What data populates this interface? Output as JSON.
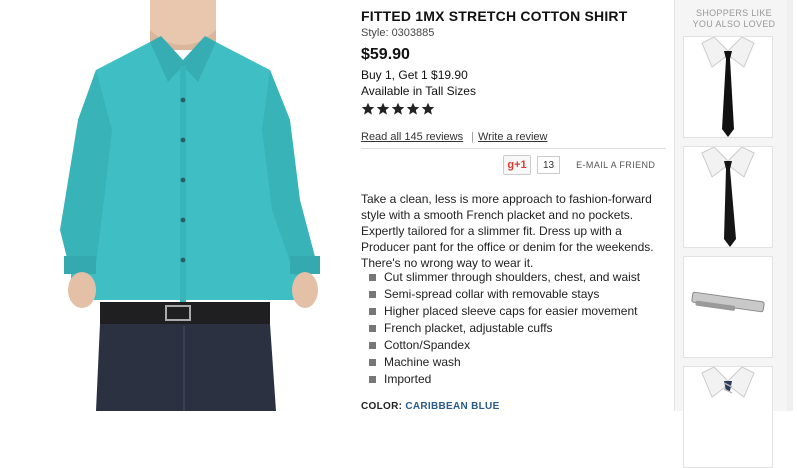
{
  "product": {
    "title": "FITTED 1MX STRETCH COTTON SHIRT",
    "style": "Style: 0303885",
    "price": "$59.90",
    "promo": "Buy 1, Get 1 $19.90",
    "availability": "Available in Tall Sizes",
    "rating": 5,
    "read_reviews": "Read all 145 reviews",
    "write_review": "Write a review",
    "gplus_label": "g+1",
    "gplus_count": "13",
    "email_friend": "E-MAIL A FRIEND",
    "description": "Take a clean, less is more approach to fashion-forward style with a smooth French placket and no pockets. Expertly tailored for a slimmer fit. Dress up with a Producer pant for the office or denim for the weekends. There's no wrong way to wear it.",
    "features": [
      "Cut slimmer through shoulders, chest, and waist",
      "Semi-spread collar with removable stays",
      "Higher placed sleeve caps for easier movement",
      "French placket, adjustable cuffs",
      "Cotton/Spandex",
      "Machine wash",
      "Imported"
    ],
    "color_label": "COLOR:",
    "color_value": "CARIBBEAN BLUE",
    "shirt_color": "#3fbfc4"
  },
  "rail": {
    "heading_line1": "SHOPPERS LIKE",
    "heading_line2": "YOU ALSO LOVED",
    "items": [
      {
        "icon": "skinny-tie-icon"
      },
      {
        "icon": "skinny-tie-icon"
      },
      {
        "icon": "tie-bar-icon"
      },
      {
        "icon": "striped-tie-icon"
      }
    ]
  }
}
